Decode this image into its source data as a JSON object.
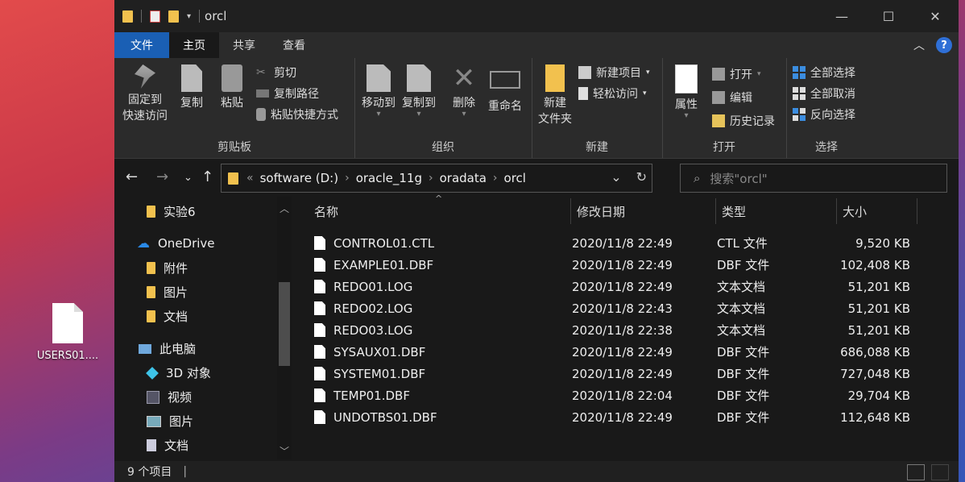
{
  "desktop": {
    "icon_label": "USERS01...."
  },
  "window": {
    "title": "orcl",
    "controls": {
      "minimize": "—",
      "maximize": "☐",
      "close": "✕"
    }
  },
  "tabs": [
    {
      "label": "文件"
    },
    {
      "label": "主页"
    },
    {
      "label": "共享"
    },
    {
      "label": "查看"
    }
  ],
  "ribbon": {
    "clipboard": {
      "label": "剪贴板",
      "pin_label1": "固定到",
      "pin_label2": "快速访问",
      "copy": "复制",
      "paste": "粘贴",
      "cut": "剪切",
      "copy_path": "复制路径",
      "paste_shortcut": "粘贴快捷方式"
    },
    "organize": {
      "label": "组织",
      "move_to": "移动到",
      "copy_to": "复制到",
      "delete": "删除",
      "rename": "重命名"
    },
    "new": {
      "label": "新建",
      "new_folder1": "新建",
      "new_folder2": "文件夹",
      "new_item": "新建项目",
      "easy_access": "轻松访问"
    },
    "open": {
      "label": "打开",
      "properties": "属性",
      "open": "打开",
      "edit": "编辑",
      "history": "历史记录"
    },
    "select": {
      "label": "选择",
      "select_all": "全部选择",
      "select_none": "全部取消",
      "invert": "反向选择"
    }
  },
  "address": {
    "crumbs": [
      "software (D:)",
      "oracle_11g",
      "oradata",
      "orcl"
    ],
    "search_placeholder": "搜索\"orcl\""
  },
  "nav": [
    {
      "label": "实验6",
      "icon": "folder-icon"
    },
    {
      "label": "OneDrive",
      "icon": "cloud-icon"
    },
    {
      "label": "附件",
      "icon": "folder-icon"
    },
    {
      "label": "图片",
      "icon": "folder-icon"
    },
    {
      "label": "文档",
      "icon": "folder-icon"
    },
    {
      "label": "此电脑",
      "icon": "computer-icon"
    },
    {
      "label": "3D 对象",
      "icon": "cube-icon"
    },
    {
      "label": "视频",
      "icon": "video-icon"
    },
    {
      "label": "图片",
      "icon": "picture-icon"
    },
    {
      "label": "文档",
      "icon": "document-icon"
    }
  ],
  "columns": {
    "name": "名称",
    "date": "修改日期",
    "type": "类型",
    "size": "大小"
  },
  "files": [
    {
      "name": "CONTROL01.CTL",
      "date": "2020/11/8 22:49",
      "type": "CTL 文件",
      "size": "9,520 KB"
    },
    {
      "name": "EXAMPLE01.DBF",
      "date": "2020/11/8 22:49",
      "type": "DBF 文件",
      "size": "102,408 KB"
    },
    {
      "name": "REDO01.LOG",
      "date": "2020/11/8 22:49",
      "type": "文本文档",
      "size": "51,201 KB"
    },
    {
      "name": "REDO02.LOG",
      "date": "2020/11/8 22:43",
      "type": "文本文档",
      "size": "51,201 KB"
    },
    {
      "name": "REDO03.LOG",
      "date": "2020/11/8 22:38",
      "type": "文本文档",
      "size": "51,201 KB"
    },
    {
      "name": "SYSAUX01.DBF",
      "date": "2020/11/8 22:49",
      "type": "DBF 文件",
      "size": "686,088 KB"
    },
    {
      "name": "SYSTEM01.DBF",
      "date": "2020/11/8 22:49",
      "type": "DBF 文件",
      "size": "727,048 KB"
    },
    {
      "name": "TEMP01.DBF",
      "date": "2020/11/8 22:04",
      "type": "DBF 文件",
      "size": "29,704 KB"
    },
    {
      "name": "UNDOTBS01.DBF",
      "date": "2020/11/8 22:49",
      "type": "DBF 文件",
      "size": "112,648 KB"
    }
  ],
  "status": {
    "count": "9 个项目"
  },
  "colors": {
    "accent": "#1a5fb4",
    "folder": "#f2c14e",
    "bg_dark": "#191919"
  }
}
